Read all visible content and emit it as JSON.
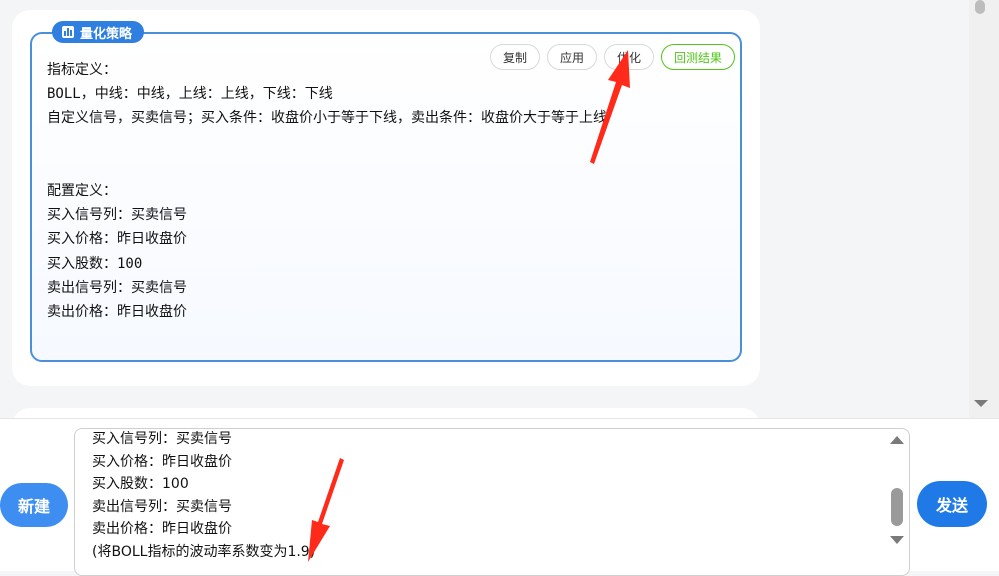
{
  "strategy_card": {
    "badge_label": "量化策略",
    "badge_icon": "chart-icon",
    "buttons": {
      "copy": "复制",
      "apply": "应用",
      "optimize": "优化",
      "backtest": "回测结果"
    },
    "content": "指标定义：\nBOLL，中线：中线，上线：上线，下线：下线\n自定义信号，买卖信号；买入条件：收盘价小于等于下线，卖出条件：收盘价大于等于上线\n\n\n配置定义：\n买入信号列：买卖信号\n买入价格：昨日收盘价\n买入股数：100\n卖出信号列：买卖信号\n卖出价格：昨日收盘价"
  },
  "input": {
    "new_label": "新建",
    "send_label": "发送",
    "text": "买入信号列：买卖信号\n买入价格：昨日收盘价\n买入股数：100\n卖出信号列：买卖信号\n卖出价格：昨日收盘价\n(将BOLL指标的波动率系数变为1.9)"
  },
  "colors": {
    "accent": "#2f7fe0",
    "backtest_green": "#52c41a",
    "annotation_red": "#ff2a1a"
  }
}
